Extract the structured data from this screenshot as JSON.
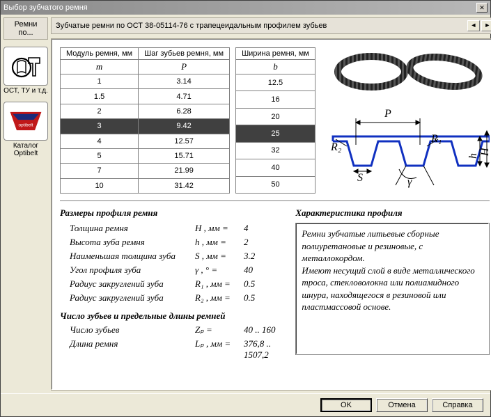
{
  "window": {
    "title": "Выбор зубчатого ремня"
  },
  "sidebar": {
    "header": "Ремни по...",
    "items": [
      {
        "label": "ОСТ, ТУ и т.д."
      },
      {
        "label": "Каталог Optibelt"
      }
    ]
  },
  "main": {
    "header": "Зубчатые ремни по ОСТ 38-05114-76 с трапецеидальным профилем зубьев"
  },
  "table_main": {
    "col1_h1": "Модуль ремня, мм",
    "col2_h1": "Шаг зубьев ремня, мм",
    "col1_h2": "m",
    "col2_h2": "P",
    "rows": [
      {
        "m": "1",
        "p": "3.14"
      },
      {
        "m": "1.5",
        "p": "4.71"
      },
      {
        "m": "2",
        "p": "6.28"
      },
      {
        "m": "3",
        "p": "9.42"
      },
      {
        "m": "4",
        "p": "12.57"
      },
      {
        "m": "5",
        "p": "15.71"
      },
      {
        "m": "7",
        "p": "21.99"
      },
      {
        "m": "10",
        "p": "31.42"
      }
    ],
    "selected_index": 3
  },
  "table_width": {
    "col_h1": "Ширина ремня, мм",
    "col_h2": "b",
    "rows": [
      "12.5",
      "16",
      "20",
      "25",
      "32",
      "40",
      "50"
    ],
    "selected_index": 3
  },
  "profile": {
    "title": "Размеры профиля ремня",
    "params": [
      {
        "label": "Толщина ремня",
        "sym": "H , мм  =",
        "val": "4"
      },
      {
        "label": "Высота зуба ремня",
        "sym": "h , мм  =",
        "val": "2"
      },
      {
        "label": "Наименьшая толщина зуба",
        "sym": "S , мм  =",
        "val": "3.2"
      },
      {
        "label": "Угол профиля зуба",
        "sym": "γ , °   =",
        "val": "40"
      },
      {
        "label": "Радиус закруглений зуба",
        "sym": "R₁ , мм =",
        "val": "0.5"
      },
      {
        "label": "Радиус закруглений зуба",
        "sym": "R₂ , мм =",
        "val": "0.5"
      }
    ],
    "sub_title": "Число зубьев и предельные длины ремней",
    "sub_params": [
      {
        "label": "Число зубьев",
        "sym": "Zₚ        =",
        "val": "40 .. 160"
      },
      {
        "label": "Длина ремня",
        "sym": "Lₚ , мм =",
        "val": "376,8 .. 1507,2"
      }
    ]
  },
  "characteristic": {
    "title": "Характеристика профиля",
    "text": "Ремни зубчатые литьевые сборные полиуретановые и резиновые, с металлокордом.\nИмеют несущий слой в виде металлического\nтроса, стекловолокна или полиамидного\nшнура, находящегося в резиновой или пластмассовой основе."
  },
  "buttons": {
    "ok": "OK",
    "cancel": "Отмена",
    "help": "Справка"
  },
  "diagram_labels": {
    "P": "P",
    "H": "H",
    "h": "h",
    "S": "S",
    "g": "γ",
    "R1": "R₁",
    "R2": "R₂"
  }
}
